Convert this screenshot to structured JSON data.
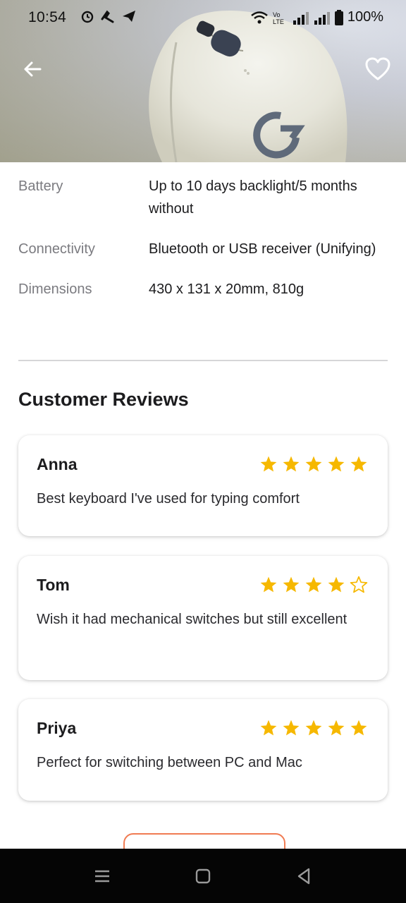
{
  "status_bar": {
    "time": "10:54",
    "battery": "100%",
    "left_icons": [
      "alarm-icon",
      "call-icon",
      "telegram-icon"
    ],
    "right_icons": [
      "wifi-icon",
      "volte-icon",
      "signal-icon",
      "signal-icon",
      "battery-icon"
    ]
  },
  "header": {
    "back_icon": "arrow-left-icon",
    "favorite_icon": "heart-outline-icon"
  },
  "specs": [
    {
      "label": "Battery",
      "value": "Up to 10 days backlight/5 months without"
    },
    {
      "label": "Connectivity",
      "value": "Bluetooth or USB receiver (Unifying)"
    },
    {
      "label": "Dimensions",
      "value": "430 x 131 x 20mm, 810g"
    }
  ],
  "reviews_section": {
    "title": "Customer Reviews",
    "reviews": [
      {
        "name": "Anna",
        "rating": 5,
        "text": "Best keyboard I've used for typing comfort"
      },
      {
        "name": "Tom",
        "rating": 4,
        "text": "Wish it had mechanical switches but still excellent"
      },
      {
        "name": "Priya",
        "rating": 5,
        "text": "Perfect for switching between PC and Mac"
      }
    ]
  },
  "colors": {
    "star": "#F6B800",
    "accent_button_border": "#F07B52",
    "label_gray": "#7B7B80"
  },
  "nav_bar": {
    "icons": [
      "menu-icon",
      "home-square-icon",
      "back-triangle-icon"
    ]
  }
}
